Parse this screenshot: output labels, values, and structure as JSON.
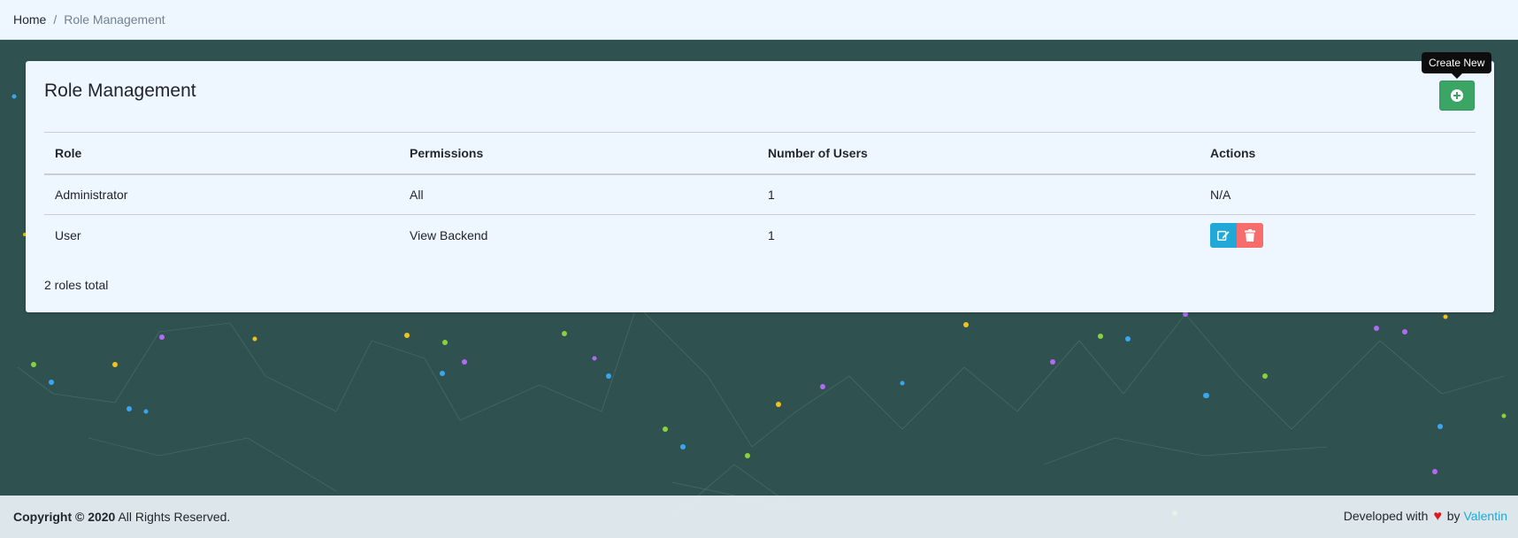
{
  "breadcrumb": {
    "home": "Home",
    "separator": "/",
    "current": "Role Management"
  },
  "card": {
    "title": "Role Management",
    "create_tooltip": "Create New",
    "create_icon": "plus-circle-icon"
  },
  "table": {
    "headers": [
      "Role",
      "Permissions",
      "Number of Users",
      "Actions"
    ],
    "rows": [
      {
        "role": "Administrator",
        "permissions": "All",
        "users": "1",
        "actions": "N/A"
      },
      {
        "role": "User",
        "permissions": "View Backend",
        "users": "1",
        "actions": ""
      }
    ],
    "total_text": "2 roles total"
  },
  "footer": {
    "copyright_bold": "Copyright © 2020",
    "copyright_rest": "All Rights Reserved.",
    "developed_with": "Developed with",
    "by": "by",
    "author": "Valentin"
  },
  "colors": {
    "background": "#2f5250",
    "panel": "#eef6ff",
    "success": "#3aa564",
    "info": "#20a8d8",
    "danger": "#f86c6b",
    "heart": "#e3161b"
  }
}
